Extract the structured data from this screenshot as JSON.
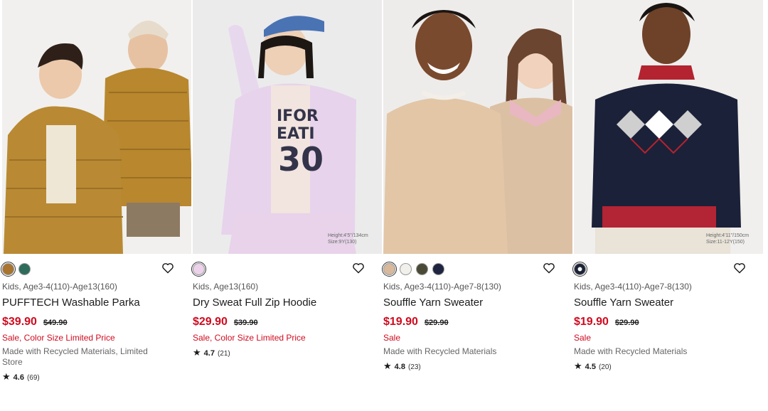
{
  "products": [
    {
      "age": "Kids, Age3-4(110)-Age13(160)",
      "name": "PUFFTECH Washable Parka",
      "price": "$39.90",
      "original_price": "$49.90",
      "promo": "Sale, Color Size Limited Price",
      "flags": "Made with Recycled Materials, Limited Store",
      "rating": "4.6",
      "review_count": "(69)",
      "size_caption": "",
      "swatches": [
        {
          "color": "#a8742e",
          "selected": true
        },
        {
          "color": "#2e6b5a",
          "selected": false
        }
      ]
    },
    {
      "age": "Kids, Age13(160)",
      "name": "Dry Sweat Full Zip Hoodie",
      "price": "$29.90",
      "original_price": "$39.90",
      "promo": "Sale, Color Size Limited Price",
      "flags": "",
      "rating": "4.7",
      "review_count": "(21)",
      "size_caption": "Height:4'5\"/134cm Size:9Y(130)",
      "swatches": [
        {
          "color": "#ecd2ea",
          "selected": true
        }
      ]
    },
    {
      "age": "Kids, Age3-4(110)-Age7-8(130)",
      "name": "Souffle Yarn Sweater",
      "price": "$19.90",
      "original_price": "$29.90",
      "promo": "Sale",
      "flags": "Made with Recycled Materials",
      "rating": "4.8",
      "review_count": "(23)",
      "size_caption": "",
      "swatches": [
        {
          "color": "#d9b99c",
          "selected": true
        },
        {
          "color": "#f2f0ea",
          "selected": false
        },
        {
          "color": "#4a4a36",
          "selected": false
        },
        {
          "color": "#1f2540",
          "selected": false
        }
      ]
    },
    {
      "age": "Kids, Age3-4(110)-Age7-8(130)",
      "name": "Souffle Yarn Sweater",
      "price": "$19.90",
      "original_price": "$29.90",
      "promo": "Sale",
      "flags": "Made with Recycled Materials",
      "rating": "4.5",
      "review_count": "(20)",
      "size_caption": "Height:4'11\"/150cm Size:11-12Y(150)",
      "swatches": [
        {
          "color": "#1c2336",
          "selected": true,
          "pattern": "argyle"
        }
      ]
    }
  ],
  "icons": {
    "favorite": "heart-outline-icon",
    "rating": "star-icon"
  }
}
